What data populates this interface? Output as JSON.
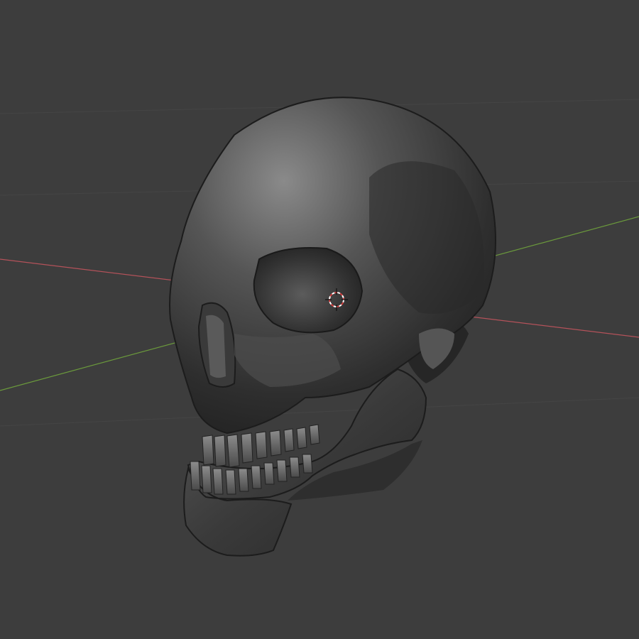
{
  "viewport": {
    "background": "#3d3d3d",
    "grid_color": "#454545",
    "x_axis_color": "#b5525a",
    "y_axis_color": "#6b9a3c",
    "object": "skull-mesh",
    "cursor": "3d-cursor-icon"
  }
}
